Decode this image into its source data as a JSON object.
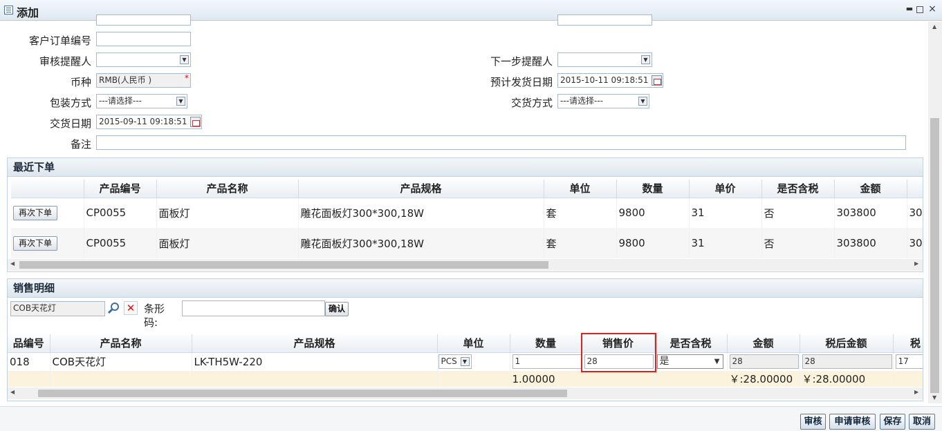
{
  "window": {
    "title": "添加"
  },
  "form": {
    "cust_order_label": "客户订单编号",
    "cust_order_value": "",
    "reviewer_label": "审核提醒人",
    "next_reminder_label": "下一步提醒人",
    "currency_label": "币种",
    "currency_value": "RMB(人民币 )",
    "currency_required": "*",
    "est_ship_label": "预计发货日期",
    "est_ship_value": "2015-10-11 09:18:51",
    "packing_label": "包装方式",
    "packing_value": "---请选择---",
    "delivery_method_label": "交货方式",
    "delivery_method_value": "---请选择---",
    "delivery_date_label": "交货日期",
    "delivery_date_value": "2015-09-11 09:18:51",
    "remark_label": "备注",
    "remark_value": ""
  },
  "recent": {
    "title": "最近下单",
    "columns": [
      "",
      "产品编号",
      "产品名称",
      "产品规格",
      "单位",
      "数量",
      "单价",
      "是否含税",
      "金额",
      ""
    ],
    "rows": [
      {
        "action": "再次下单",
        "code": "CP0055",
        "name": "面板灯",
        "spec": "雕花面板灯300*300,18W",
        "unit": "套",
        "qty": "9800",
        "price": "31",
        "tax": "否",
        "amount": "303800",
        "extra": "30"
      },
      {
        "action": "再次下单",
        "code": "CP0055",
        "name": "面板灯",
        "spec": "雕花面板灯300*300,18W",
        "unit": "套",
        "qty": "9800",
        "price": "31",
        "tax": "否",
        "amount": "303800",
        "extra": "30"
      }
    ]
  },
  "sales": {
    "title": "销售明细",
    "search_value": "COB天花灯",
    "barcode_label": "条形码:",
    "barcode_value": "",
    "confirm_label": "确认",
    "columns": [
      "品编号",
      "产品名称",
      "产品规格",
      "单位",
      "数量",
      "销售价",
      "是否含税",
      "金额",
      "税后金额",
      "税"
    ],
    "row": {
      "code": "018",
      "name": "COB天花灯",
      "spec": "LK-TH5W-220",
      "unit": "PCS",
      "qty": "1",
      "price": "28",
      "tax": "是",
      "amount": "28",
      "after_tax": "28",
      "tax_val": "17"
    },
    "summary": {
      "qty": "1.00000",
      "amount": "￥:28.00000",
      "after_tax": "￥:28.00000"
    }
  },
  "actions": {
    "review": "审核",
    "apply_review": "申请审核",
    "save": "保存",
    "cancel": "取消"
  },
  "colors": {
    "highlight": "#e0201c",
    "summary_bg": "#fcf3dc",
    "panel_header": "#dde6ee"
  }
}
